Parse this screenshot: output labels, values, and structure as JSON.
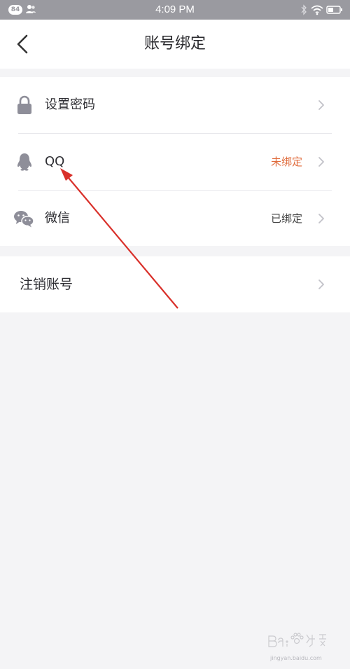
{
  "status_bar": {
    "badge": "84",
    "time": "4:09 PM"
  },
  "header": {
    "title": "账号绑定",
    "back_icon": "chevron-left-icon"
  },
  "account_items": [
    {
      "icon": "lock-icon",
      "label": "设置密码",
      "status": ""
    },
    {
      "icon": "qq-penguin-icon",
      "label": "QQ",
      "status": "未绑定",
      "status_color": "#e06a3a"
    },
    {
      "icon": "wechat-icon",
      "label": "微信",
      "status": "已绑定",
      "status_color": "#444444"
    }
  ],
  "logout": {
    "label": "注销账号"
  },
  "colors": {
    "background": "#f4f4f6",
    "accent_unbound": "#e06a3a",
    "icon_gray": "#8e8e99",
    "annotation_arrow": "#d9302a"
  },
  "watermark": {
    "brand": "Baidu 经验",
    "domain": "jingyan.baidu.com"
  }
}
